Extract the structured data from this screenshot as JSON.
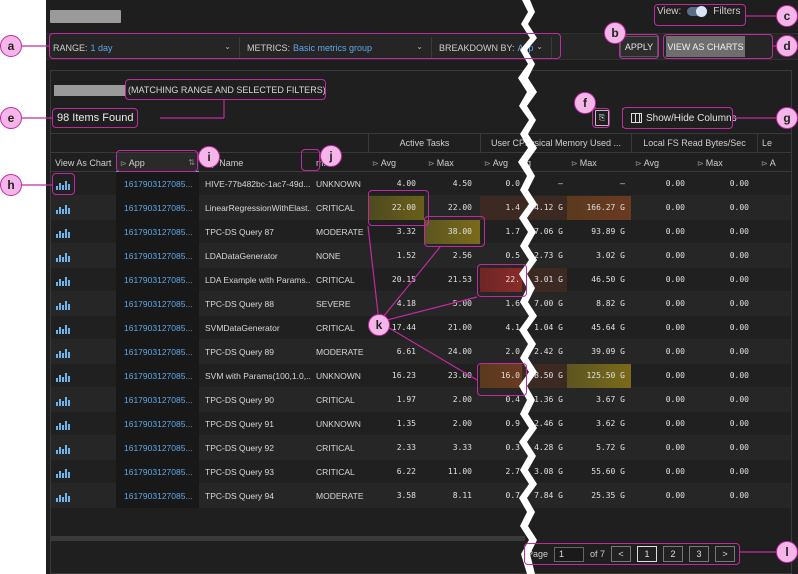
{
  "header": {
    "view_label": "View:",
    "filters_label": "Filters"
  },
  "toolbar": {
    "range_label": "RANGE:",
    "range_value": "1 day",
    "metrics_label": "METRICS:",
    "metrics_value": "Basic metrics group",
    "breakdown_label": "BREAKDOWN BY:",
    "breakdown_value": "App",
    "apply_label": "APPLY",
    "view_charts_label": "VIEW AS CHARTS"
  },
  "summary": {
    "matching_text": "(MATCHING RANGE AND SELECTED FILTERS)",
    "items_found": "98 Items Found",
    "show_hide_label": "Show/Hide Columns"
  },
  "table": {
    "groups": {
      "active_tasks": "Active Tasks",
      "user_memory": "User CPhysical Memory Used ...",
      "local_fs": "Local FS Read Bytes/Sec",
      "last": "Le"
    },
    "columns": {
      "view_as_chart": "View As Chart",
      "app": "App",
      "app_name": "p Name",
      "status": "m...",
      "avg": "Avg",
      "max": "Max",
      "um_b": "g",
      "last": "A"
    },
    "rows": [
      {
        "app": "1617903127085...",
        "name": "HIVE-77b482bc-1ac7-49d...",
        "status": "UNKNOWN",
        "at_avg": "4.00",
        "at_max": "4.50",
        "um_avg": "0.0",
        "um_b": "–",
        "um_max": "–",
        "fs_avg": "0.00",
        "fs_max": "0.00"
      },
      {
        "app": "1617903127085...",
        "name": "LinearRegressionWithElast...",
        "status": "CRITICAL",
        "at_avg": "22.00",
        "at_max": "22.00",
        "um_avg": "1.4",
        "um_b": "4.12 G",
        "um_max": "166.27 G",
        "fs_avg": "0.00",
        "fs_max": "0.00"
      },
      {
        "app": "1617903127085...",
        "name": "TPC-DS Query 87",
        "status": "MODERATE",
        "at_avg": "3.32",
        "at_max": "38.00",
        "um_avg": "1.7",
        "um_b": "7.06 G",
        "um_max": "93.89 G",
        "fs_avg": "0.00",
        "fs_max": "0.00"
      },
      {
        "app": "1617903127085...",
        "name": "LDADataGenerator",
        "status": "NONE",
        "at_avg": "1.52",
        "at_max": "2.56",
        "um_avg": "0.5",
        "um_b": "2.73 G",
        "um_max": "3.02 G",
        "fs_avg": "0.00",
        "fs_max": "0.00"
      },
      {
        "app": "1617903127085...",
        "name": "LDA Example with Params...",
        "status": "CRITICAL",
        "at_avg": "20.15",
        "at_max": "21.53",
        "um_avg": "22.",
        "um_b": "3.01 G",
        "um_max": "46.50 G",
        "fs_avg": "0.00",
        "fs_max": "0.00"
      },
      {
        "app": "1617903127085...",
        "name": "TPC-DS Query 88",
        "status": "SEVERE",
        "at_avg": "4.18",
        "at_max": "5.00",
        "um_avg": "1.6",
        "um_b": "7.00 G",
        "um_max": "8.82 G",
        "fs_avg": "0.00",
        "fs_max": "0.00"
      },
      {
        "app": "1617903127085...",
        "name": "SVMDataGenerator",
        "status": "CRITICAL",
        "at_avg": "17.44",
        "at_max": "21.00",
        "um_avg": "4.1",
        "um_b": "1.04 G",
        "um_max": "45.64 G",
        "fs_avg": "0.00",
        "fs_max": "0.00"
      },
      {
        "app": "1617903127085...",
        "name": "TPC-DS Query 89",
        "status": "MODERATE",
        "at_avg": "6.61",
        "at_max": "24.00",
        "um_avg": "2.0",
        "um_b": "2.42 G",
        "um_max": "39.09 G",
        "fs_avg": "0.00",
        "fs_max": "0.00"
      },
      {
        "app": "1617903127085...",
        "name": "SVM with Params(100,1.0,...",
        "status": "UNKNOWN",
        "at_avg": "16.23",
        "at_max": "23.00",
        "um_avg": "16.0",
        "um_b": "8.50 G",
        "um_max": "125.50 G",
        "fs_avg": "0.00",
        "fs_max": "0.00"
      },
      {
        "app": "1617903127085...",
        "name": "TPC-DS Query 90",
        "status": "CRITICAL",
        "at_avg": "1.97",
        "at_max": "2.00",
        "um_avg": "0.4",
        "um_b": "1.36 G",
        "um_max": "3.67 G",
        "fs_avg": "0.00",
        "fs_max": "0.00"
      },
      {
        "app": "1617903127085...",
        "name": "TPC-DS Query 91",
        "status": "UNKNOWN",
        "at_avg": "1.35",
        "at_max": "2.00",
        "um_avg": "0.9",
        "um_b": "2.46 G",
        "um_max": "3.62 G",
        "fs_avg": "0.00",
        "fs_max": "0.00"
      },
      {
        "app": "1617903127085...",
        "name": "TPC-DS Query 92",
        "status": "CRITICAL",
        "at_avg": "2.33",
        "at_max": "3.33",
        "um_avg": "0.3",
        "um_b": "4.28 G",
        "um_max": "5.72 G",
        "fs_avg": "0.00",
        "fs_max": "0.00"
      },
      {
        "app": "1617903127085...",
        "name": "TPC-DS Query 93",
        "status": "CRITICAL",
        "at_avg": "6.22",
        "at_max": "11.00",
        "um_avg": "2.7",
        "um_b": "3.08 G",
        "um_max": "55.60 G",
        "fs_avg": "0.00",
        "fs_max": "0.00"
      },
      {
        "app": "1617903127085...",
        "name": "TPC-DS Query 94",
        "status": "MODERATE",
        "at_avg": "3.58",
        "at_max": "8.11",
        "um_avg": "0.7",
        "um_b": "7.84 G",
        "um_max": "25.35 G",
        "fs_avg": "0.00",
        "fs_max": "0.00"
      }
    ]
  },
  "pager": {
    "page_label": "Page",
    "page_value": "1",
    "of_text": "of 7",
    "prev": "<",
    "next": ">",
    "pages": [
      "1",
      "2",
      "3"
    ]
  },
  "callouts": [
    "a",
    "b",
    "c",
    "d",
    "e",
    "f",
    "g",
    "h",
    "i",
    "j",
    "k",
    "l"
  ],
  "colors": {
    "accent": "#5fa8e6",
    "callout_fill": "#f4b6e8",
    "callout_border": "#c02aa0",
    "heat_red": "#8a2a2a",
    "heat_olive": "#6a5f1a"
  }
}
